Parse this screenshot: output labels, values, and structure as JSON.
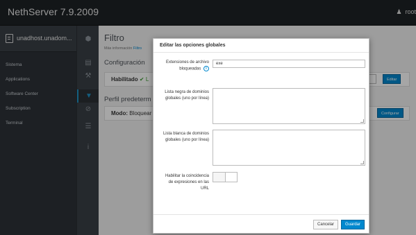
{
  "app": {
    "title": "NethServer 7.9.2009",
    "user": "root"
  },
  "sidebar": {
    "hostname": "unadhost.unadom...",
    "items": [
      {
        "label": "Sistema"
      },
      {
        "label": "Applications"
      },
      {
        "label": "Software Center"
      },
      {
        "label": "Subscription"
      },
      {
        "label": "Terminal"
      }
    ]
  },
  "rail": {
    "icons": [
      {
        "name": "cube-icon",
        "glyph": "⬢"
      },
      {
        "name": "server-icon",
        "glyph": "▤"
      },
      {
        "name": "wrench-icon",
        "glyph": "⚒"
      },
      {
        "name": "filter-icon",
        "glyph": "▼"
      },
      {
        "name": "ban-icon",
        "glyph": "⊘"
      },
      {
        "name": "list-icon",
        "glyph": "☰"
      },
      {
        "name": "info-icon",
        "glyph": "i"
      }
    ]
  },
  "page": {
    "title": "Filtro",
    "more_info_prefix": "Más información",
    "more_info_link": "Filtro",
    "config_heading": "Configuración",
    "status_label": "Habilitado",
    "status_check": "✔",
    "status_suffix": "L",
    "edit_button": "Editar",
    "profile_heading": "Perfil predeterm",
    "mode_label": "Modo:",
    "mode_value": "Bloquear",
    "configure_button": "Configurar"
  },
  "modal": {
    "title": "Editar las opciones globales",
    "fields": {
      "extensions_label": "Extensiones de archivo bloqueadas",
      "extensions_value": "exe",
      "blacklist_label": "Lista negra de dominios globales (uno por línea)",
      "blacklist_value": "",
      "whitelist_label": "Lista blanca de dominios globales (uno por línea)",
      "whitelist_value": "",
      "url_expr_label": "Habilitar la coincidencia de expresiones en las URL",
      "url_expr_enabled": false
    },
    "cancel_label": "Cancelar",
    "save_label": "Guardar"
  },
  "colors": {
    "accent": "#0088ce",
    "success": "#3f9c35",
    "topbar": "#1e2226",
    "sidebar": "#2d3238"
  }
}
